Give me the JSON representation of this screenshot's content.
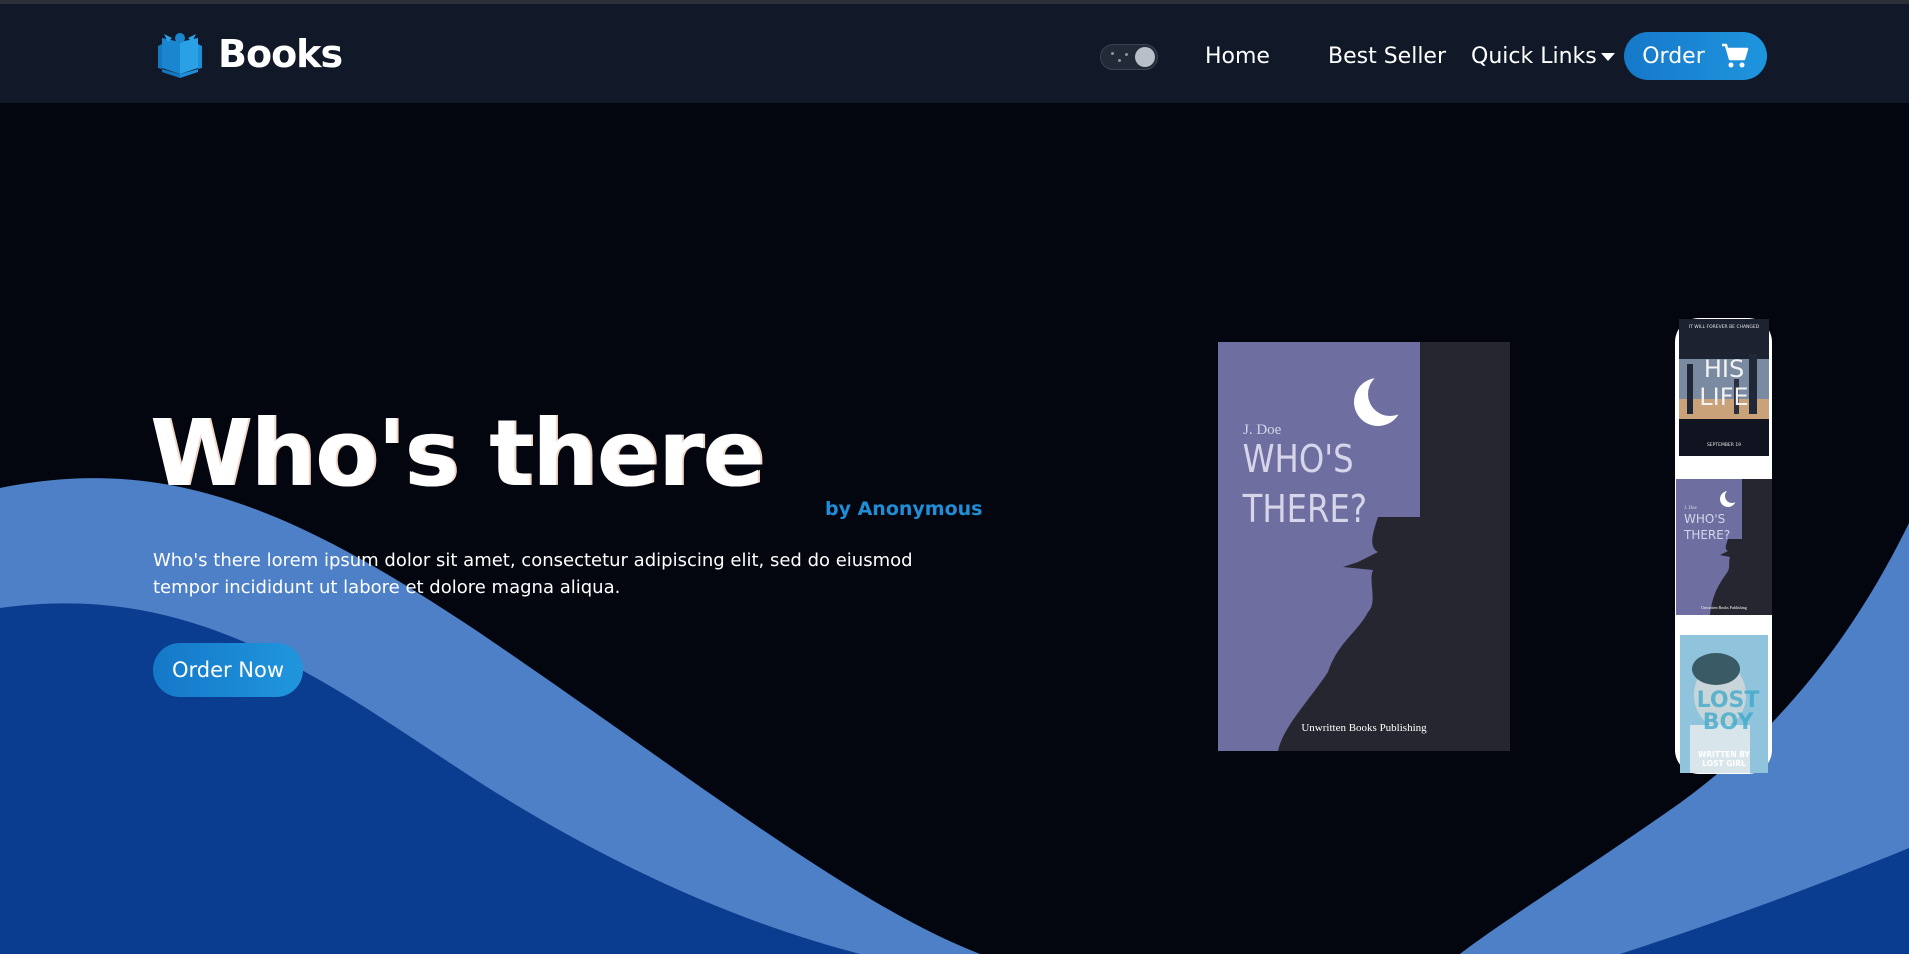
{
  "nav": {
    "brand": "Books",
    "links": [
      "Home",
      "Best Seller",
      "Quick Links"
    ],
    "order_label": "Order"
  },
  "hero": {
    "title": "Who's there",
    "author": "by Anonymous",
    "description": "Who's there lorem ipsum dolor sit amet, consectetur adipiscing elit, sed do eiusmod tempor incididunt ut labore et dolore magna aliqua.",
    "cta": "Order Now"
  },
  "covers": {
    "main": {
      "author": "J. Doe",
      "title_line1": "WHO'S",
      "title_line2": "THERE?",
      "publisher": "Unwritten Books Publishing"
    },
    "thumb1": {
      "tagline": "IT WILL FOREVER BE CHANGED",
      "title_line1": "HIS",
      "title_line2": "LIFE",
      "date": "SEPTEMBER 19"
    },
    "thumb2": {
      "author": "J. Doe",
      "title_line1": "WHO'S",
      "title_line2": "THERE?",
      "publisher": "Unwritten Books Publishing"
    },
    "thumb3": {
      "title_line1": "LOST",
      "title_line2": "BOY",
      "credit_line1": "WRITTEN BY",
      "credit_line2": "LOST GIRL"
    }
  },
  "colors": {
    "accent": "#1e8fd6",
    "navbar": "#111827",
    "background": "#03060f",
    "wave_light": "#4e80c8",
    "wave_dark": "#0a3c8f",
    "cover_purple": "#6f6ea0"
  },
  "icons": {
    "brand": "open-book-icon",
    "cart": "cart-icon",
    "theme_toggle": "theme-toggle",
    "dropdown": "caret-down-icon"
  }
}
